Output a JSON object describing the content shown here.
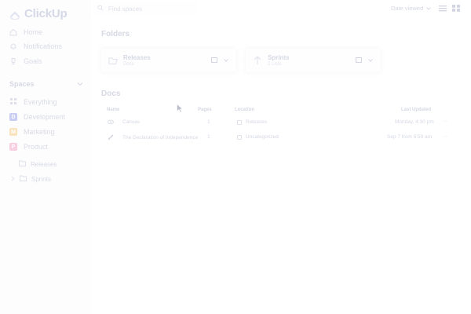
{
  "app": {
    "name": "ClickUp"
  },
  "sidebar": {
    "nav": [
      {
        "label": "Home",
        "icon": "home-icon"
      },
      {
        "label": "Notifications",
        "icon": "bell-icon"
      },
      {
        "label": "Goals",
        "icon": "trophy-icon"
      }
    ],
    "spaces_header": "Spaces",
    "spaces": [
      {
        "label": "Everything",
        "icon": "grid-icon"
      },
      {
        "label": "Development",
        "badge": "D",
        "color": "#9aa3f0"
      },
      {
        "label": "Marketing",
        "badge": "M",
        "color": "#f3cf8c"
      },
      {
        "label": "Product",
        "badge": "P",
        "color": "#f2a7c5"
      }
    ],
    "folders": [
      {
        "label": "Releases",
        "icon": "folder-icon"
      },
      {
        "label": "Sprints",
        "icon": "folder-icon"
      }
    ]
  },
  "topbar": {
    "search_placeholder": "Find spaces",
    "sort_label": "Date viewed"
  },
  "folders_section": {
    "title": "Folders",
    "cards": [
      {
        "name": "Releases",
        "sub": "Docs"
      },
      {
        "name": "Sprints",
        "sub": "2 Lists"
      }
    ]
  },
  "docs_section": {
    "title": "Docs",
    "columns": {
      "name": "Name",
      "pages": "Pages",
      "location": "Location",
      "updated": "Last Updated"
    },
    "rows": [
      {
        "name": "Canvas",
        "pages": "1",
        "location": "Releases",
        "updated": "Monday, 4:30 pm"
      },
      {
        "name": "The Declaration of Independence",
        "pages": "1",
        "location": "Uncategorized",
        "updated": "Sep 7 from 9:59 am"
      }
    ]
  }
}
